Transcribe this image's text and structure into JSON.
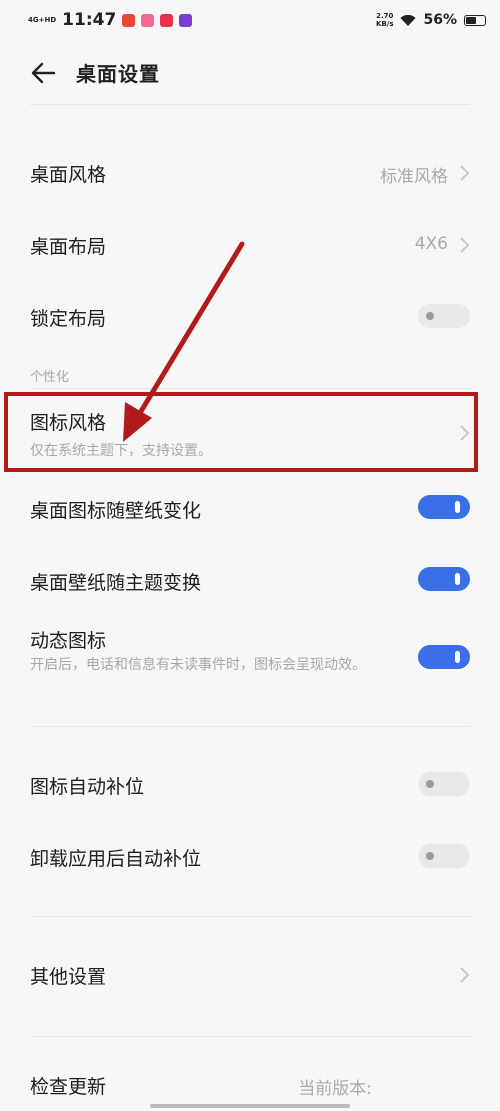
{
  "status_bar": {
    "network": "4G+HD",
    "time": "11:47",
    "speed_value": "2.70",
    "speed_unit": "KB/s",
    "battery": "56%",
    "battery_level": 0.56
  },
  "header": {
    "title": "桌面设置"
  },
  "rows": {
    "desktop_style": {
      "label": "桌面风格",
      "value": "标准风格"
    },
    "desktop_layout": {
      "label": "桌面布局",
      "value": "4X6"
    },
    "lock_layout": {
      "label": "锁定布局",
      "toggle": "off"
    },
    "section_personalize": "个性化",
    "icon_style": {
      "label": "图标风格",
      "subtext": "仅在系统主题下，支持设置。"
    },
    "icon_follow_wallpaper": {
      "label": "桌面图标随壁纸变化",
      "toggle": "on"
    },
    "wallpaper_follow_theme": {
      "label": "桌面壁纸随主题变换",
      "toggle": "on"
    },
    "dynamic_icon": {
      "label": "动态图标",
      "subtext": "开启后，电话和信息有未读事件时，图标会呈现动效。",
      "toggle": "on"
    },
    "icon_auto_fill": {
      "label": "图标自动补位",
      "toggle": "off"
    },
    "uninstall_auto_fill": {
      "label": "卸载应用后自动补位",
      "toggle": "off"
    },
    "other_settings": {
      "label": "其他设置"
    },
    "check_update": {
      "label": "检查更新",
      "value": "当前版本:"
    }
  },
  "colors": {
    "accent": "#3b6fe8",
    "annotation": "#b21b1b"
  }
}
